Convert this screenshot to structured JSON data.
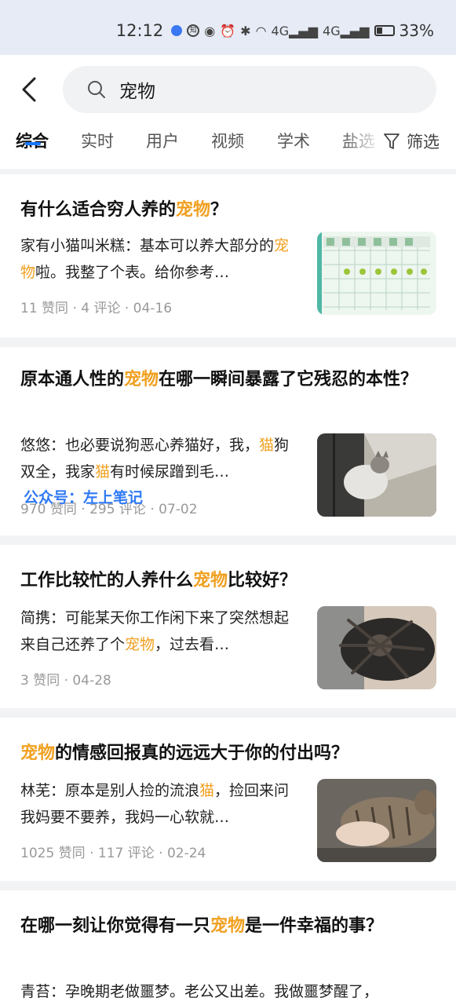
{
  "status_bar": {
    "time": "12:12",
    "battery": "33%",
    "signal_labels": [
      "4G",
      "4G"
    ]
  },
  "search": {
    "query": "宠物"
  },
  "tabs": [
    "综合",
    "实时",
    "用户",
    "视频",
    "学术",
    "盐选"
  ],
  "filter_label": "筛选",
  "watermark": "公众号：左上笔记",
  "colors": {
    "accent": "#1677ff",
    "highlight": "#f0a020",
    "watermark": "#2f7af5"
  },
  "cards": [
    {
      "title": [
        "有什么适合穷人养的",
        "宠物",
        "？"
      ],
      "excerpt": [
        "家有小猫叫米糕：基本可以养大部分的",
        "宠物",
        "啦。我整了个表。给你参考…"
      ],
      "meta": "11 赞同 · 4 评论 · 04-16",
      "image": "pet-comparison-table"
    },
    {
      "title": [
        "原本通人性的",
        "宠物",
        "在哪一瞬间暴露了它残忍的本性？"
      ],
      "excerpt": [
        "悠悠：也必要说狗恶心养猫好，我，",
        "猫",
        "狗双全，我家",
        "猫",
        "有时候尿蹭到毛…"
      ],
      "meta": "970 赞同 · 295 评论 · 07-02",
      "image": "cat-photo"
    },
    {
      "title": [
        "工作比较忙的人养什么",
        "宠物",
        "比较好？"
      ],
      "excerpt": [
        "简携：可能某天你工作闲下来了突然想起来自己还养了个",
        "宠物",
        "，过去看…"
      ],
      "meta": "3 赞同 · 04-28",
      "image": "tarantula-photo"
    },
    {
      "title": [
        "",
        "宠物",
        "的情感回报真的远远大于你的付出吗？"
      ],
      "excerpt": [
        "林芜：原本是别人捡的流浪",
        "猫",
        "，捡回来问我妈要不要养，我妈一心软就…"
      ],
      "meta": "1025 赞同 · 117 评论 · 02-24",
      "image": "tabby-cat-photo"
    },
    {
      "title": [
        "在哪一刻让你觉得有一只",
        "宠物",
        "是一件幸福的事？"
      ],
      "excerpt": [
        "青苔：孕晚期老做噩梦。老公又出差。我做噩梦醒了，"
      ],
      "meta": "",
      "image": ""
    }
  ]
}
